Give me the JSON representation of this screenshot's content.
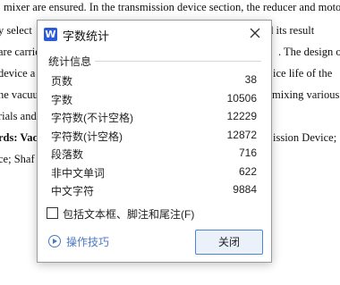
{
  "document": {
    "lines": [
      "mixer are ensured. In the transmission device section, the reducer and motor",
      "y select",
      "n and its result",
      "are carrie",
      ". The design of",
      "device a",
      "ice life of the",
      "he vacuu",
      "mixing various",
      "rials and",
      "rds: Vac",
      "ission Device;",
      "ce; Shaf"
    ]
  },
  "dialog": {
    "app_icon_letter": "W",
    "title": "字数统计",
    "group_label": "统计信息",
    "stats": [
      {
        "label": "页数",
        "value": "38"
      },
      {
        "label": "字数",
        "value": "10506"
      },
      {
        "label": "字符数(不计空格)",
        "value": "12229"
      },
      {
        "label": "字符数(计空格)",
        "value": "12872"
      },
      {
        "label": "段落数",
        "value": "716"
      },
      {
        "label": "非中文单词",
        "value": "622"
      },
      {
        "label": "中文字符",
        "value": "9884"
      }
    ],
    "checkbox_label": "包括文本框、脚注和尾注(F)",
    "checkbox_checked": false,
    "tips_label": "操作技巧",
    "close_button_label": "关闭"
  },
  "colors": {
    "accent": "#4a78c8",
    "app_icon": "#2a5cd8",
    "button_border": "#4a86d8",
    "button_bg": "#eaf1fb"
  },
  "icons": [
    "app-w-icon",
    "close-icon",
    "play-circle-icon"
  ]
}
